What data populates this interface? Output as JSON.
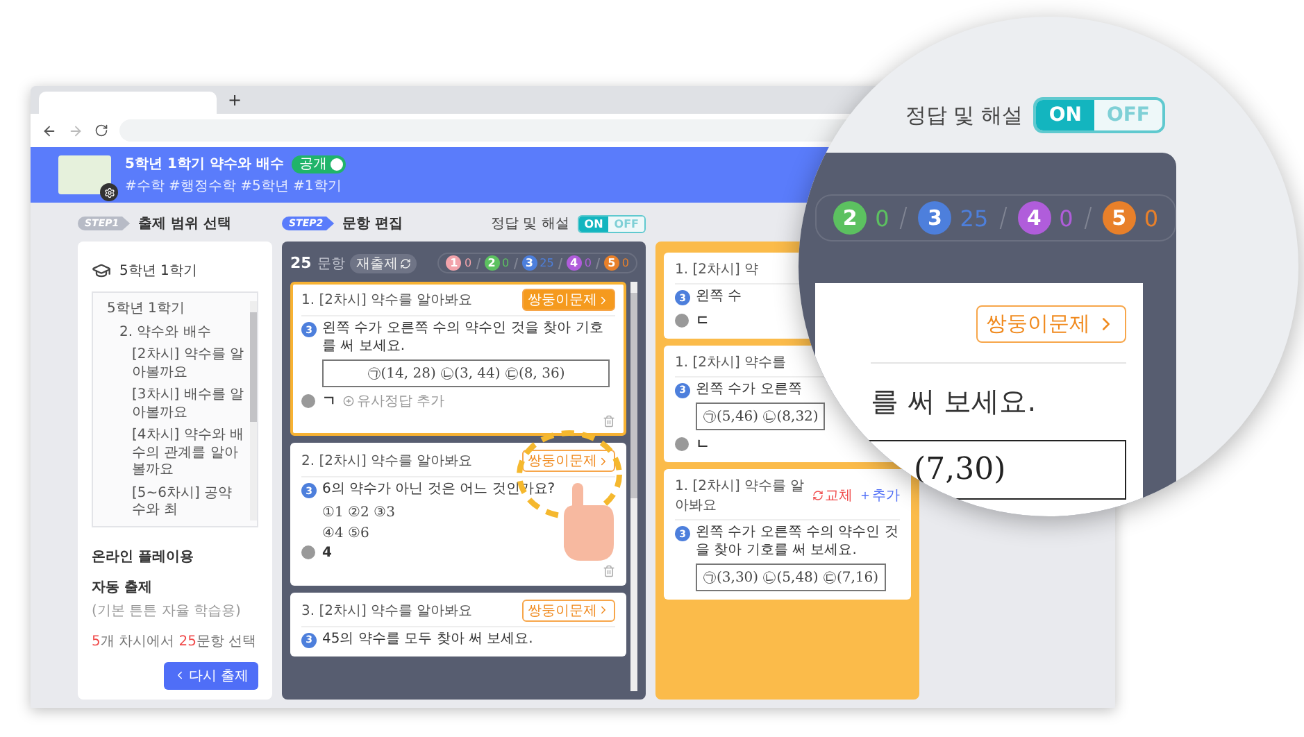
{
  "browser": {
    "new_tab": "+"
  },
  "header": {
    "title": "5학년 1학기 약수와 배수",
    "public_toggle": {
      "label": "공개",
      "on": true
    },
    "tags": "#수학 #행정수학 #5학년 #1학기"
  },
  "step1": {
    "badge": "STEP1",
    "title": "출제 범위 선택"
  },
  "scope": {
    "grade": "5학년 1학기",
    "tree": [
      {
        "label": "5학년 1학기",
        "children": [
          {
            "label": "2. 약수와 배수",
            "children": [
              {
                "label": "[2차시] 약수를 알아볼까요"
              },
              {
                "label": "[3차시] 배수를 알아볼까요"
              },
              {
                "label": "[4차시] 약수와 배수의 관계를 알아볼까요"
              },
              {
                "label": "[5~6차시] 공약수와 최"
              }
            ]
          }
        ]
      }
    ],
    "online_label": "온라인 플레이용",
    "auto_title": "자동 출제",
    "auto_note": "(기본 튼튼 자율 학습용)",
    "summary": [
      {
        "text": "5",
        "highlight": true
      },
      {
        "text": "개 차시에서 ",
        "highlight": false
      },
      {
        "text": "25",
        "highlight": true
      },
      {
        "text": "문항 선택",
        "highlight": false
      }
    ],
    "regenerate_button": "다시 출제"
  },
  "step2": {
    "badge": "STEP2",
    "title": "문항 편집",
    "answer_toggle": {
      "label": "정답 및 해설",
      "on": true,
      "on_text": "ON",
      "off_text": "OFF"
    }
  },
  "editor": {
    "count": "25",
    "unit": "문항",
    "reshuffle": "재출제",
    "levels": [
      {
        "level": "1",
        "count": "0",
        "color": "#f2a3ab"
      },
      {
        "level": "2",
        "count": "0",
        "color": "#5cc160"
      },
      {
        "level": "3",
        "count": "25",
        "color": "#4d7fdc"
      },
      {
        "level": "4",
        "count": "0",
        "color": "#b05ddb"
      },
      {
        "level": "5",
        "count": "0",
        "color": "#e8802a"
      }
    ],
    "questions": [
      {
        "title": "1. [2차시] 약수를 알아봐요",
        "twin_button": "쌍둥이문제",
        "selected": true,
        "number": "3",
        "text": "왼쪽 수가 오른쪽 수의 약수인 것을 찾아 기호를 써 보세요.",
        "choices": {
          "kind": "boxed",
          "lines": [
            "㉠(14, 28)  ㉡(3, 44)  ㉢(8, 36)"
          ]
        },
        "answer": "ㄱ",
        "add_similar": "유사정답 추가"
      },
      {
        "title": "2. [2차시] 약수를 알아봐요",
        "twin_button": "쌍둥이문제",
        "selected": false,
        "number": "3",
        "text": "6의 약수가 아닌 것은 어느 것인가요?",
        "choices": {
          "kind": "list",
          "lines": [
            "①1   ②2   ③3",
            "④4   ⑤6"
          ]
        },
        "answer": "4"
      },
      {
        "title": "3. [2차시] 약수를 알아봐요",
        "twin_button": "쌍둥이문제",
        "selected": false,
        "number": "3",
        "text": "45의 약수를 모두 찾아 써 보세요."
      }
    ]
  },
  "twins": [
    {
      "title": "1. [2차시] 약",
      "number": "3",
      "text": "왼쪽 수",
      "answer": "ㄷ"
    },
    {
      "title": "1. [2차시] 약수를",
      "number": "3",
      "text": "왼쪽 수가 오른쪽",
      "choices": {
        "kind": "boxed",
        "lines": [
          "㉠(5,46)  ㉡(8,32)"
        ]
      },
      "answer": "ㄴ"
    },
    {
      "title": "1. [2차시] 약수를 알아봐요",
      "actions": [
        {
          "kind": "replace",
          "label": "교체"
        },
        {
          "kind": "add",
          "label": "추가"
        }
      ],
      "number": "3",
      "text": "왼쪽 수가 오른쪽 수의 약수인 것을 찾아 기호를 써 보세요.",
      "choices": {
        "kind": "boxed",
        "lines": [
          "㉠(3,30)  ㉡(5,48)  ㉢(7,16)"
        ]
      }
    }
  ],
  "magnifier": {
    "answer_toggle": {
      "label": "정답 및 해설",
      "on": true,
      "on_text": "ON",
      "off_text": "OFF"
    },
    "levels": [
      {
        "level": "2",
        "count": "0",
        "color": "#5cc160"
      },
      {
        "level": "3",
        "count": "25",
        "color": "#4d7fdc"
      },
      {
        "level": "4",
        "count": "0",
        "color": "#b05ddb"
      },
      {
        "level": "5",
        "count": "0",
        "color": "#e8802a"
      }
    ],
    "twin_button": "쌍둥이문제",
    "question_fragment": "를 써 보세요.",
    "choices_fragment": "(7,30)"
  }
}
